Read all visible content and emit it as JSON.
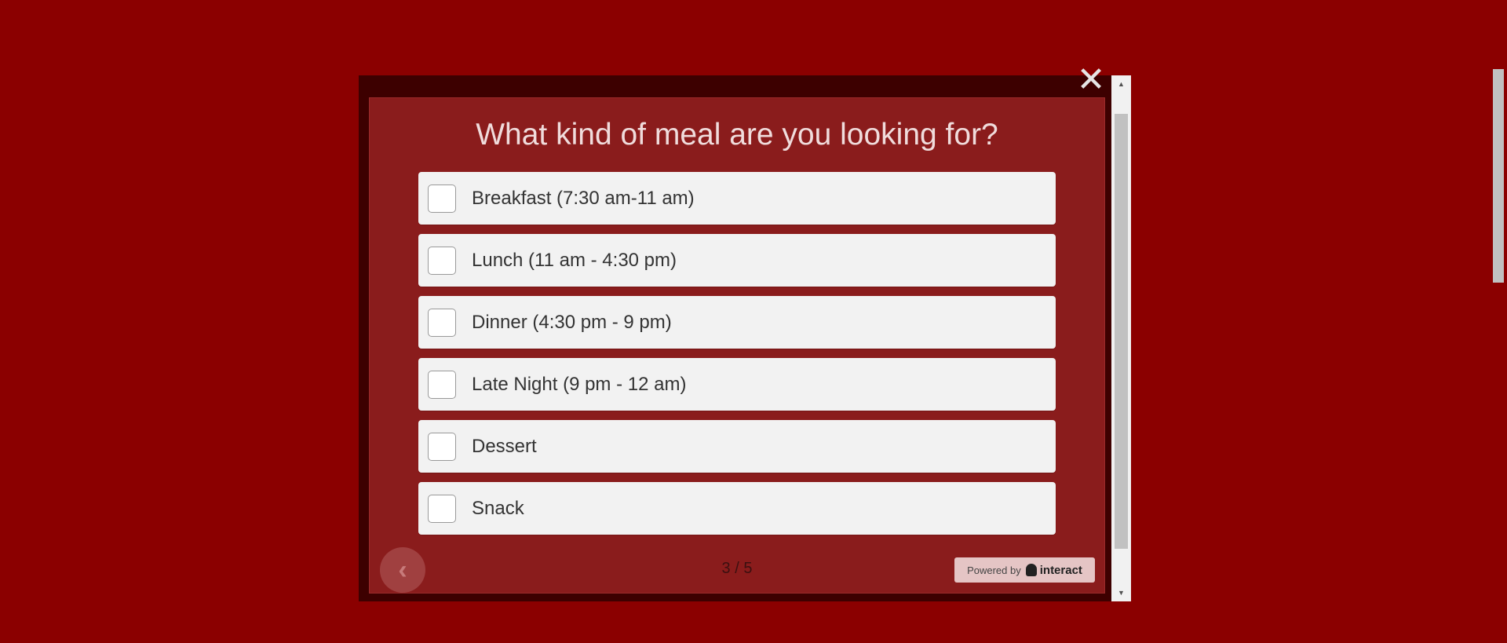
{
  "quiz": {
    "question": "What kind of meal are you looking for?",
    "answers": [
      {
        "label": "Breakfast (7:30 am-11 am)",
        "checked": false
      },
      {
        "label": "Lunch (11 am - 4:30 pm)",
        "checked": false
      },
      {
        "label": "Dinner (4:30 pm - 9 pm)",
        "checked": false
      },
      {
        "label": "Late Night (9 pm - 12 am)",
        "checked": false
      },
      {
        "label": "Dessert",
        "checked": false
      },
      {
        "label": "Snack",
        "checked": false
      }
    ],
    "progress": "3 / 5",
    "powered_by": "Powered by",
    "brand": "interact",
    "prev_icon": "chevron-left-icon",
    "close_icon": "close-icon"
  },
  "colors": {
    "page_background": "#8b0000",
    "card_background": "#8a1c1c",
    "answer_background": "#f2f2f2"
  }
}
